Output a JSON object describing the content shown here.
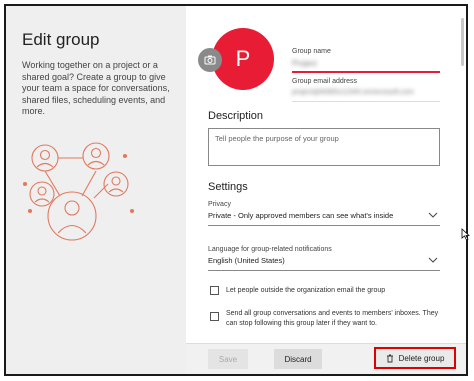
{
  "left": {
    "title": "Edit group",
    "description": "Working together on a project or a shared goal? Create a group to give your team a space for conversations, shared files, scheduling events, and more."
  },
  "avatar": {
    "initial": "P",
    "color": "#e81c34"
  },
  "group_name": {
    "label": "Group name",
    "value": "Project"
  },
  "group_email": {
    "label": "Group email address",
    "value": "project@M365x12345.onmicrosoft.com"
  },
  "description": {
    "heading": "Description",
    "placeholder": "Tell people the purpose of your group"
  },
  "settings": {
    "heading": "Settings",
    "privacy_label": "Privacy",
    "privacy_value": "Private - Only approved members can see what's inside",
    "language_label": "Language for group-related notifications",
    "language_value": "English (United States)",
    "checkbox_external": "Let people outside the organization email the group",
    "checkbox_send_line1": "Send all group conversations and events to members' inboxes. They",
    "checkbox_send_line2": "can stop following this group later if they want to."
  },
  "footer": {
    "save_label": "Save",
    "discard_label": "Discard",
    "delete_label": "Delete group"
  },
  "colors": {
    "accent": "#e81c34",
    "highlight_box": "#e00000",
    "illustration": "#e07a5f"
  }
}
